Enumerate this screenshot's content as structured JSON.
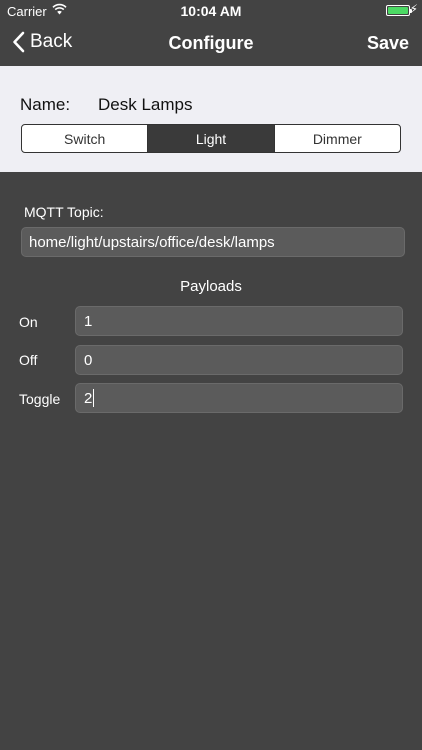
{
  "status_bar": {
    "carrier": "Carrier",
    "time": "10:04 AM",
    "battery_level": 1.0,
    "battery_color": "#4cd964"
  },
  "nav": {
    "back_label": "Back",
    "title": "Configure",
    "save_label": "Save"
  },
  "device": {
    "name_label": "Name:",
    "name_value": "Desk Lamps",
    "types": [
      "Switch",
      "Light",
      "Dimmer"
    ],
    "selected_type": "Light"
  },
  "mqtt": {
    "label": "MQTT Topic:",
    "topic": "home/light/upstairs/office/desk/lamps"
  },
  "payloads": {
    "title": "Payloads",
    "on_label": "On",
    "on_value": "1",
    "off_label": "Off",
    "off_value": "0",
    "toggle_label": "Toggle",
    "toggle_value": "2"
  },
  "colors": {
    "background": "#434343",
    "header_panel": "#efeff4",
    "field": "#5b5b5b",
    "selected_segment": "#3a3a3a"
  }
}
